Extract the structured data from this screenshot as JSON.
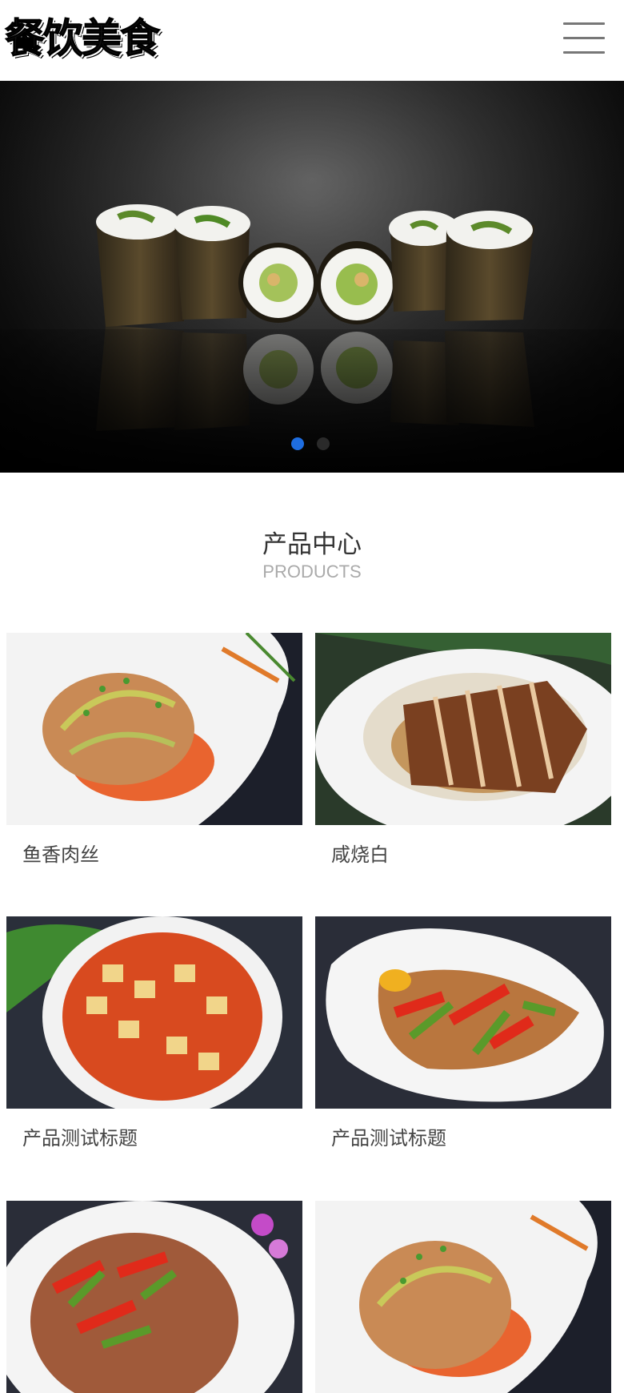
{
  "header": {
    "logo_text": "餐饮美食",
    "menu_icon": "hamburger-menu-icon"
  },
  "banner": {
    "image_alt": "sushi rolls on reflective black surface",
    "slides_count": 2,
    "active_slide": 1,
    "colors": {
      "active_dot": "#1e6de0",
      "inactive_dot": "#2a2a2a"
    }
  },
  "products": {
    "title": "产品中心",
    "subtitle": "PRODUCTS",
    "items": [
      {
        "name": "鱼香肉丝",
        "image": "shredded-pork-dish"
      },
      {
        "name": "咸烧白",
        "image": "braised-pork-belly-dish"
      },
      {
        "name": "产品测试标题",
        "image": "mapo-tofu-dish"
      },
      {
        "name": "产品测试标题",
        "image": "stir-fried-meat-peppers-dish"
      },
      {
        "name": "",
        "image": "pork-with-peppers-dish"
      },
      {
        "name": "",
        "image": "shredded-pork-dish-2"
      }
    ]
  }
}
